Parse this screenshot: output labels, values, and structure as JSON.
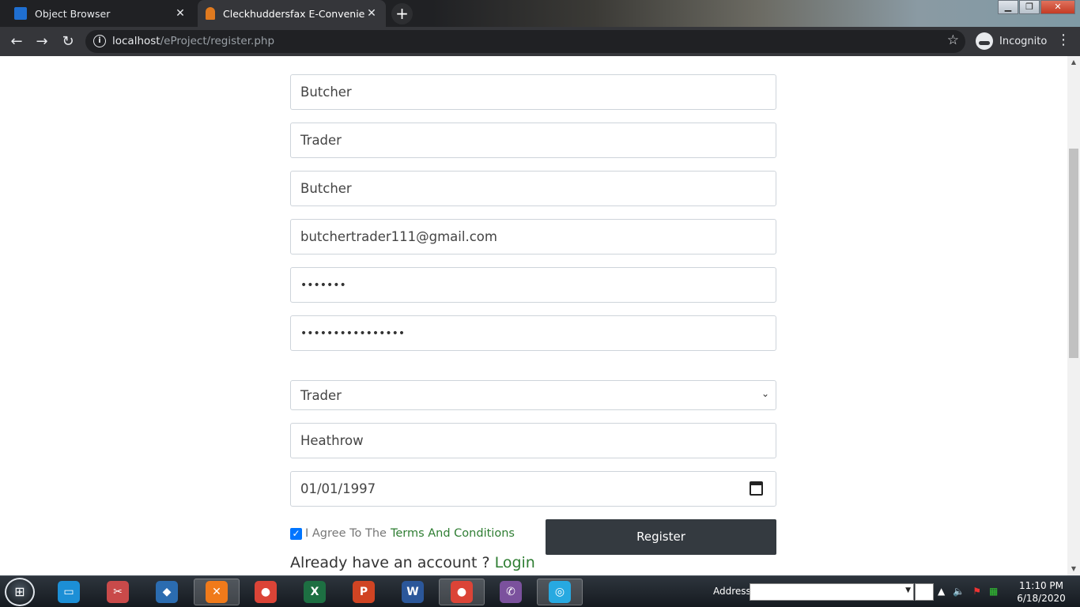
{
  "browser": {
    "tabs": [
      {
        "title": "Object Browser",
        "active": false,
        "close": "✕"
      },
      {
        "title": "Cleckhuddersfax E-Convenient St",
        "active": true,
        "close": "✕"
      }
    ],
    "new_tab": "+",
    "url_host": "localhost",
    "url_path": "/eProject/register.php",
    "profile_label": "Incognito"
  },
  "form": {
    "first_name": "Butcher",
    "last_name": "Trader",
    "username": "Butcher",
    "email": "butchertrader111@gmail.com",
    "password": "•••••••",
    "confirm_password": "••••••••••••••••",
    "role": "Trader",
    "address": "Heathrow",
    "dob": "01/01/1997",
    "agree_prefix": "I Agree To The",
    "terms_link": "Terms And Conditions",
    "register_label": "Register",
    "have_account": "Already have an account ?",
    "login_link": "Login"
  },
  "taskbar": {
    "address_label": "Address",
    "time": "11:10 PM",
    "date": "6/18/2020",
    "apps": [
      {
        "name": "file-manager",
        "color": "#1c8fd6",
        "glyph": "▭"
      },
      {
        "name": "snipping-tool",
        "color": "#c94a4a",
        "glyph": "✂"
      },
      {
        "name": "virtualbox",
        "color": "#2b6cb0",
        "glyph": "◆"
      },
      {
        "name": "xampp",
        "color": "#f07a1a",
        "glyph": "✕"
      },
      {
        "name": "chrome",
        "color": "#db4437",
        "glyph": "●"
      },
      {
        "name": "excel",
        "color": "#1d6f42",
        "glyph": "X"
      },
      {
        "name": "powerpoint",
        "color": "#d04423",
        "glyph": "P"
      },
      {
        "name": "word",
        "color": "#2b579a",
        "glyph": "W"
      },
      {
        "name": "chrome-active",
        "color": "#db4437",
        "glyph": "●"
      },
      {
        "name": "viber",
        "color": "#7b519d",
        "glyph": "✆"
      },
      {
        "name": "eye-app",
        "color": "#27a9e1",
        "glyph": "◎"
      }
    ]
  }
}
